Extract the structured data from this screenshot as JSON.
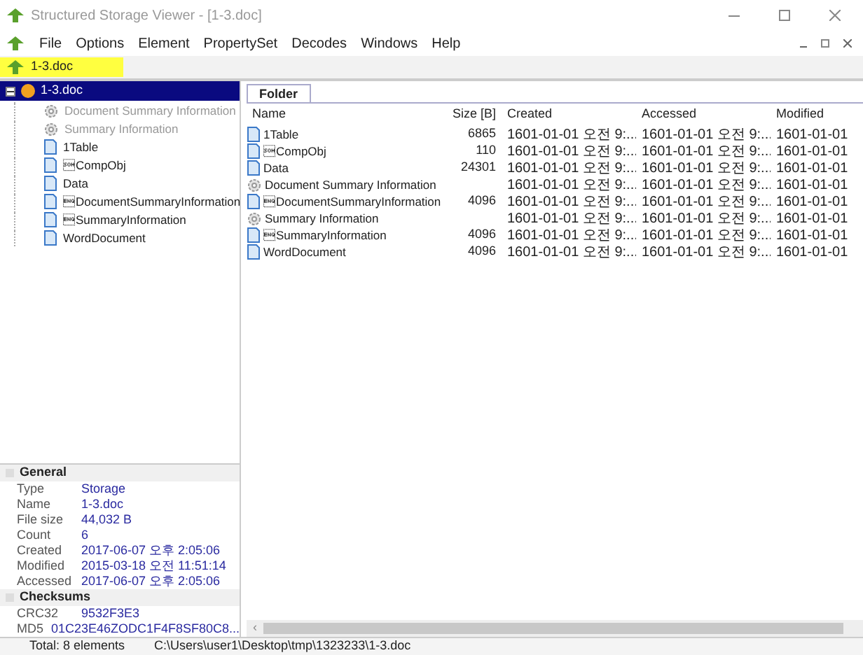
{
  "window": {
    "title": "Structured Storage Viewer - [1-3.doc]"
  },
  "menu": [
    "File",
    "Options",
    "Element",
    "PropertySet",
    "Decodes",
    "Windows",
    "Help"
  ],
  "path_field": {
    "value": "1-3.doc"
  },
  "tree": {
    "label": "1-3.doc",
    "selected": true,
    "expanded": true,
    "children": [
      {
        "label": "Document Summary Information",
        "kind": "propset"
      },
      {
        "label": "Summary Information",
        "kind": "propset"
      },
      {
        "label": "1Table",
        "kind": "stream"
      },
      {
        "label": "\u0001CompObj",
        "kind": "stream"
      },
      {
        "label": "Data",
        "kind": "stream"
      },
      {
        "label": "\u0005DocumentSummaryInformation",
        "kind": "stream"
      },
      {
        "label": "\u0005SummaryInformation",
        "kind": "stream"
      },
      {
        "label": "WordDocument",
        "kind": "stream"
      }
    ]
  },
  "properties": [
    {
      "category": "General",
      "expanded": true,
      "rows": [
        [
          "Type",
          "Storage"
        ],
        [
          "Name",
          "1-3.doc"
        ],
        [
          "File size",
          "44,032 B"
        ],
        [
          "Count",
          "6"
        ],
        [
          "Created",
          "2017-06-07 오후 2:05:06"
        ],
        [
          "Modified",
          "2015-03-18 오전 11:51:14"
        ],
        [
          "Accessed",
          "2017-06-07 오후 2:05:06"
        ]
      ]
    },
    {
      "category": "Checksums",
      "expanded": true,
      "rows": [
        [
          "CRC32",
          "9532F3E3"
        ],
        [
          "MD5",
          "01C23E46ZODC1F4F8SF80C8..."
        ]
      ]
    }
  ],
  "tabs": [
    {
      "label": "Folder",
      "selected": true
    }
  ],
  "table": {
    "columns": [
      "Name",
      "Size [B]",
      "Created",
      "Accessed",
      "Modified"
    ],
    "rows": [
      {
        "kind": "stream",
        "cells": [
          "1Table",
          "6865",
          "1601-01-01 오전 9:...",
          "1601-01-01 오전 9:...",
          "1601-01-01"
        ]
      },
      {
        "kind": "stream",
        "cells": [
          "\u0001CompObj",
          "110",
          "1601-01-01 오전 9:...",
          "1601-01-01 오전 9:...",
          "1601-01-01"
        ]
      },
      {
        "kind": "stream",
        "cells": [
          "Data",
          "24301",
          "1601-01-01 오전 9:...",
          "1601-01-01 오전 9:...",
          "1601-01-01"
        ]
      },
      {
        "kind": "propset",
        "cells": [
          "Document Summary Information",
          "",
          "1601-01-01 오전 9:...",
          "1601-01-01 오전 9:...",
          "1601-01-01"
        ]
      },
      {
        "kind": "stream",
        "cells": [
          "\u0005DocumentSummaryInformation",
          "4096",
          "1601-01-01 오전 9:...",
          "1601-01-01 오전 9:...",
          "1601-01-01"
        ]
      },
      {
        "kind": "propset",
        "cells": [
          "Summary Information",
          "",
          "1601-01-01 오전 9:...",
          "1601-01-01 오전 9:...",
          "1601-01-01"
        ]
      },
      {
        "kind": "stream",
        "cells": [
          "\u0005SummaryInformation",
          "4096",
          "1601-01-01 오전 9:...",
          "1601-01-01 오전 9:...",
          "1601-01-01"
        ]
      },
      {
        "kind": "stream",
        "cells": [
          "WordDocument",
          "4096",
          "1601-01-01 오전 9:...",
          "1601-01-01 오전 9:...",
          "1601-01-01"
        ]
      }
    ]
  },
  "scrollbar": {
    "left_arrow": "‹"
  },
  "status_bar": {
    "count": "Total: 8 elements",
    "path": "C:\\Users\\user1\\Desktop\\tmp\\1323233\\1-3.doc"
  }
}
